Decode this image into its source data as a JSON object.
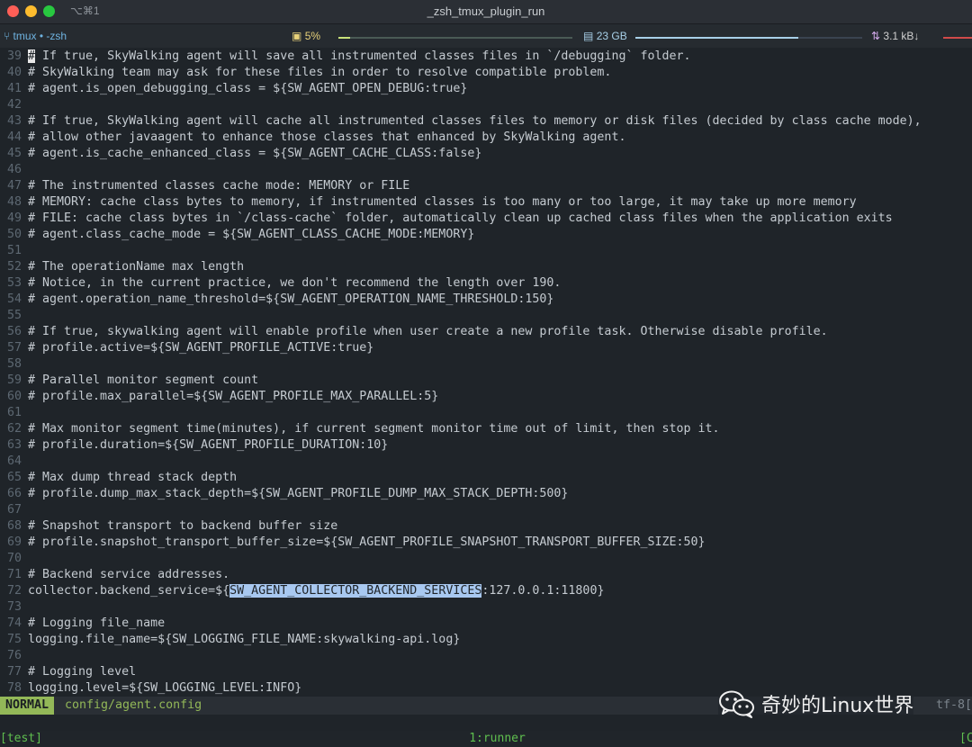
{
  "titlebar": {
    "shortcut": "⌥⌘1",
    "title": "_zsh_tmux_plugin_run"
  },
  "statusbar": {
    "session": "tmux • -zsh",
    "cpu": "5%",
    "memory": "23 GB",
    "network": "3.1 kB↓",
    "cpu_fraction": 0.05,
    "memory_fraction": 0.72
  },
  "editor": {
    "lines": [
      {
        "n": "39",
        "t": "# If true, SkyWalking agent will save all instrumented classes files in `/debugging` folder."
      },
      {
        "n": "40",
        "t": "# SkyWalking team may ask for these files in order to resolve compatible problem."
      },
      {
        "n": "41",
        "t": "# agent.is_open_debugging_class = ${SW_AGENT_OPEN_DEBUG:true}"
      },
      {
        "n": "42",
        "t": ""
      },
      {
        "n": "43",
        "t": "# If true, SkyWalking agent will cache all instrumented classes files to memory or disk files (decided by class cache mode),"
      },
      {
        "n": "44",
        "t": "# allow other javaagent to enhance those classes that enhanced by SkyWalking agent."
      },
      {
        "n": "45",
        "t": "# agent.is_cache_enhanced_class = ${SW_AGENT_CACHE_CLASS:false}"
      },
      {
        "n": "46",
        "t": ""
      },
      {
        "n": "47",
        "t": "# The instrumented classes cache mode: MEMORY or FILE"
      },
      {
        "n": "48",
        "t": "# MEMORY: cache class bytes to memory, if instrumented classes is too many or too large, it may take up more memory"
      },
      {
        "n": "49",
        "t": "# FILE: cache class bytes in `/class-cache` folder, automatically clean up cached class files when the application exits"
      },
      {
        "n": "50",
        "t": "# agent.class_cache_mode = ${SW_AGENT_CLASS_CACHE_MODE:MEMORY}"
      },
      {
        "n": "51",
        "t": ""
      },
      {
        "n": "52",
        "t": "# The operationName max length"
      },
      {
        "n": "53",
        "t": "# Notice, in the current practice, we don't recommend the length over 190."
      },
      {
        "n": "54",
        "t": "# agent.operation_name_threshold=${SW_AGENT_OPERATION_NAME_THRESHOLD:150}"
      },
      {
        "n": "55",
        "t": ""
      },
      {
        "n": "56",
        "t": "# If true, skywalking agent will enable profile when user create a new profile task. Otherwise disable profile."
      },
      {
        "n": "57",
        "t": "# profile.active=${SW_AGENT_PROFILE_ACTIVE:true}"
      },
      {
        "n": "58",
        "t": ""
      },
      {
        "n": "59",
        "t": "# Parallel monitor segment count"
      },
      {
        "n": "60",
        "t": "# profile.max_parallel=${SW_AGENT_PROFILE_MAX_PARALLEL:5}"
      },
      {
        "n": "61",
        "t": ""
      },
      {
        "n": "62",
        "t": "# Max monitor segment time(minutes), if current segment monitor time out of limit, then stop it."
      },
      {
        "n": "63",
        "t": "# profile.duration=${SW_AGENT_PROFILE_DURATION:10}"
      },
      {
        "n": "64",
        "t": ""
      },
      {
        "n": "65",
        "t": "# Max dump thread stack depth"
      },
      {
        "n": "66",
        "t": "# profile.dump_max_stack_depth=${SW_AGENT_PROFILE_DUMP_MAX_STACK_DEPTH:500}"
      },
      {
        "n": "67",
        "t": ""
      },
      {
        "n": "68",
        "t": "# Snapshot transport to backend buffer size"
      },
      {
        "n": "69",
        "t": "# profile.snapshot_transport_buffer_size=${SW_AGENT_PROFILE_SNAPSHOT_TRANSPORT_BUFFER_SIZE:50}"
      },
      {
        "n": "70",
        "t": ""
      },
      {
        "n": "71",
        "t": "# Backend service addresses."
      },
      {
        "n": "72",
        "t": "collector.backend_service=${",
        "hl": "SW_AGENT_COLLECTOR_BACKEND_SERVICES",
        "t2": ":127.0.0.1:11800}"
      },
      {
        "n": "73",
        "t": ""
      },
      {
        "n": "74",
        "t": "# Logging file_name"
      },
      {
        "n": "75",
        "t": "logging.file_name=${SW_LOGGING_FILE_NAME:skywalking-api.log}"
      },
      {
        "n": "76",
        "t": ""
      },
      {
        "n": "77",
        "t": "# Logging level"
      },
      {
        "n": "78",
        "t": "logging.level=${SW_LOGGING_LEVEL:INFO}"
      }
    ]
  },
  "modeline": {
    "mode": "NORMAL",
    "file": "config/agent.config",
    "encoding": "tf-8["
  },
  "watermark": {
    "text": "奇妙的Linux世界"
  },
  "tmux": {
    "session": "[test]",
    "window": "1:runner",
    "right": "[C"
  }
}
